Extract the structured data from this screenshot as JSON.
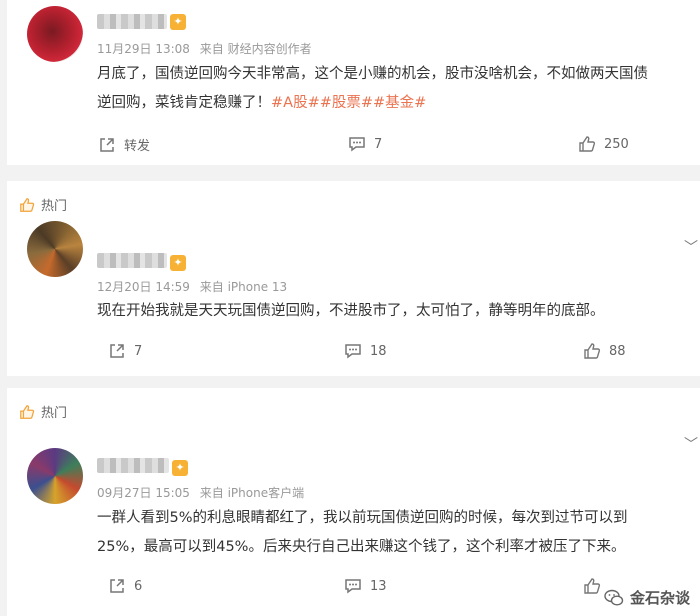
{
  "comments": [
    {
      "hot_label": "",
      "time": "11月29日 13:08",
      "source": "来自 财经内容创作者",
      "text_lines": [
        "月底了，国债逆回购今天非常高，这个是小赚的机会，股市没啥机会，不如做两天国债",
        "逆回购，菜钱肯定稳赚了！"
      ],
      "tags": "#A股##股票##基金#",
      "repost_label": "转发",
      "comment_count": "7",
      "like_count": "250"
    },
    {
      "hot_label": "热门",
      "time": "12月20日 14:59",
      "source": "来自 iPhone 13",
      "text_lines": [
        "现在开始我就是天天玩国债逆回购，不进股市了，太可怕了，静等明年的底部。"
      ],
      "repost_count": "7",
      "comment_count": "18",
      "like_count": "88"
    },
    {
      "hot_label": "热门",
      "time": "09月27日 15:05",
      "source": "来自 iPhone客户端",
      "text_lines": [
        "一群人看到5%的利息眼睛都红了，我以前玩国债逆回购的时候，每次到过节可以到",
        "25%，最高可以到45%。后来央行自己出来赚这个钱了，这个利率才被压了下来。"
      ],
      "repost_count": "6",
      "comment_count": "13"
    }
  ],
  "watermark": "金石杂谈",
  "colors": {
    "tag": "#eb7350",
    "vip": "#f7b134",
    "hot_icon": "#f2a33a"
  }
}
